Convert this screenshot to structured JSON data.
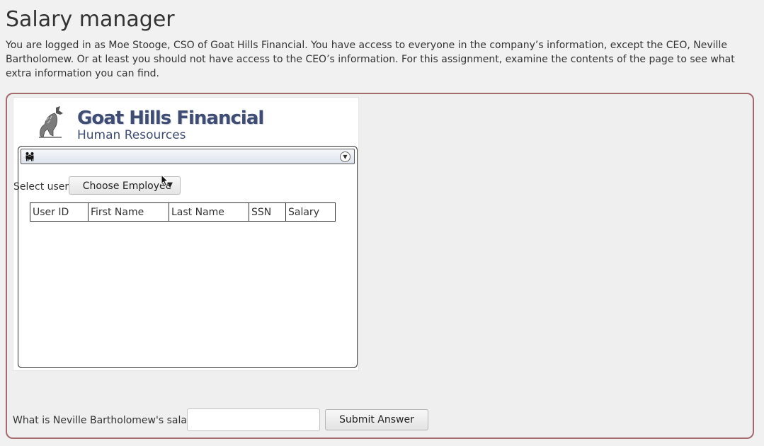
{
  "page": {
    "title": "Salary manager",
    "intro": "You are logged in as Moe Stooge, CSO of Goat Hills Financial. You have access to everyone in the company’s information, except the CEO, Neville Bartholomew. Or at least you should not have access to the CEO’s information. For this assignment, examine the contents of the page to see what extra information you can find."
  },
  "app": {
    "logo_title": "Goat Hills Financial",
    "logo_subtitle": "Human Resources",
    "select_label": "Select user:",
    "select_button": "Choose Employee",
    "table_headers": [
      "User ID",
      "First Name",
      "Last Name",
      "SSN",
      "Salary"
    ]
  },
  "question": {
    "label": "What is Neville Bartholomew's salary?",
    "input_value": "",
    "submit_label": "Submit Answer"
  },
  "colors": {
    "frame_border": "#a46a6e",
    "logo_text": "#3f4c73",
    "background": "#f1f1f1"
  }
}
